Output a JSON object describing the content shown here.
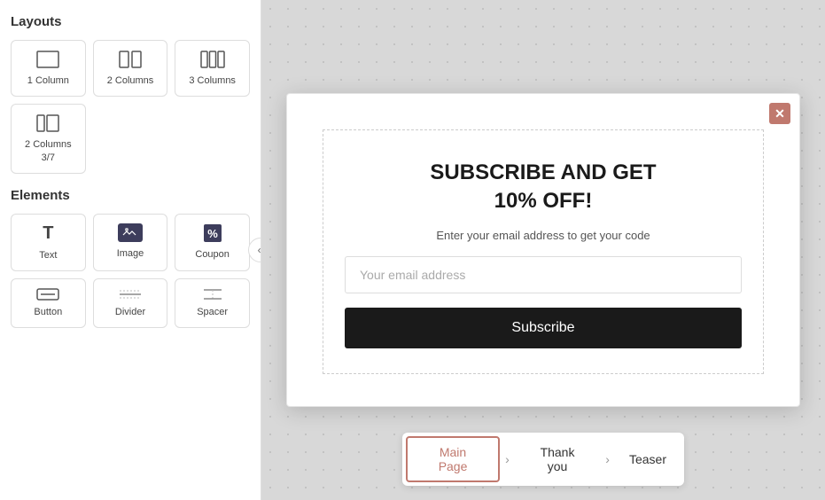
{
  "sidebar": {
    "layouts_title": "Layouts",
    "elements_title": "Elements",
    "layouts": [
      {
        "id": "1col",
        "label": "1 Column",
        "icon": "rect"
      },
      {
        "id": "2col",
        "label": "2 Columns",
        "icon": "2col"
      },
      {
        "id": "3col",
        "label": "3 Columns",
        "icon": "3col"
      },
      {
        "id": "2col37",
        "label": "2 Columns\n3/7",
        "icon": "2col37"
      }
    ],
    "elements": [
      {
        "id": "text",
        "label": "Text",
        "icon": "T"
      },
      {
        "id": "image",
        "label": "Image",
        "icon": "img"
      },
      {
        "id": "coupon",
        "label": "Coupon",
        "icon": "%"
      },
      {
        "id": "button",
        "label": "Button",
        "icon": "btn"
      },
      {
        "id": "divider",
        "label": "Divider",
        "icon": "div"
      },
      {
        "id": "spacer",
        "label": "Spacer",
        "icon": "spc"
      }
    ]
  },
  "popup": {
    "title": "SUBSCRIBE AND GET\n10% OFF!",
    "subtitle": "Enter your email address to get your code",
    "input_placeholder": "Your email address",
    "button_label": "Subscribe",
    "close_label": "✕"
  },
  "bottom_tabs": {
    "items": [
      {
        "id": "main",
        "label": "Main Page",
        "active": true
      },
      {
        "id": "thankyou",
        "label": "Thank you",
        "active": false
      },
      {
        "id": "teaser",
        "label": "Teaser",
        "active": false
      }
    ]
  }
}
